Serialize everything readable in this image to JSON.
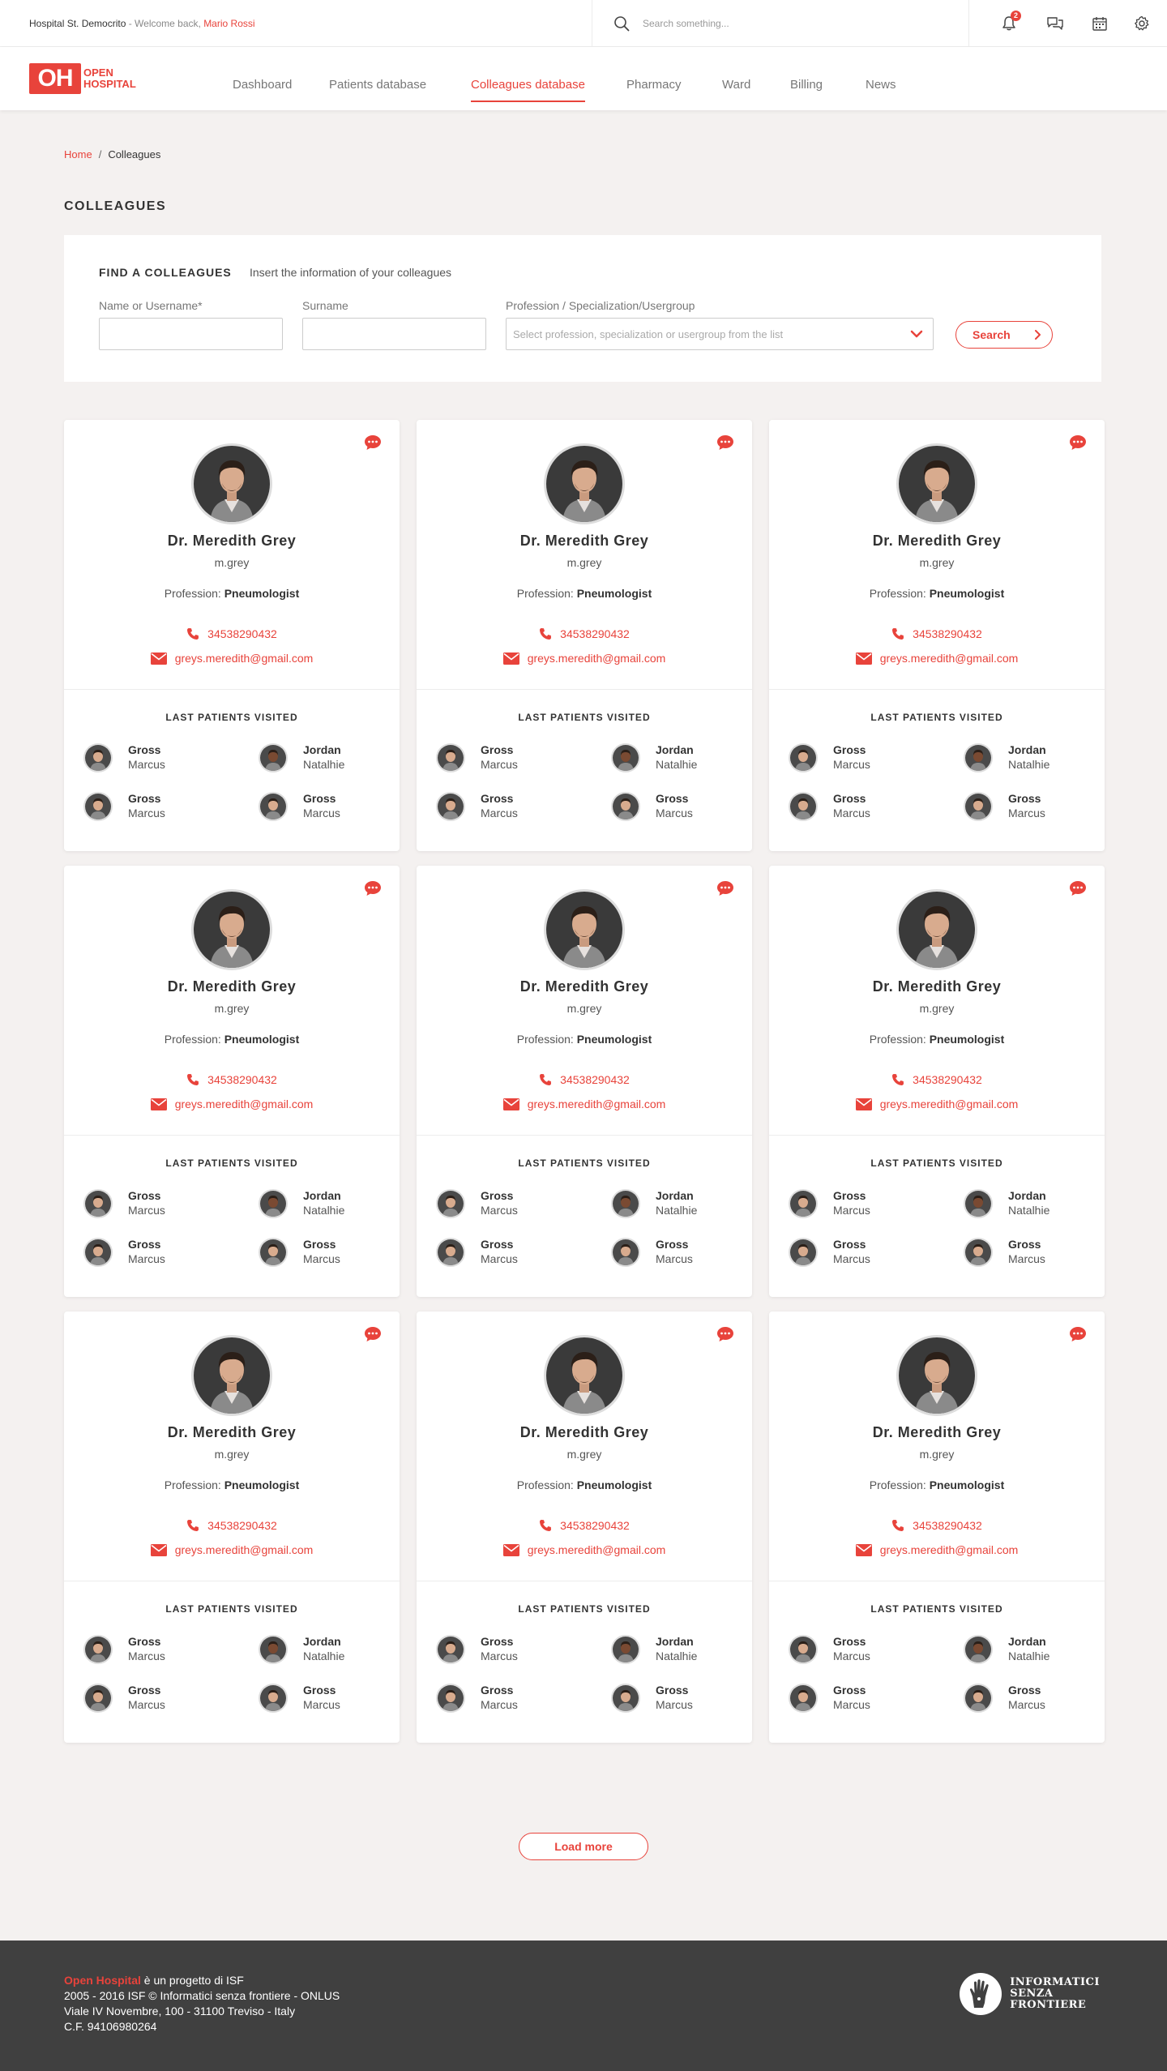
{
  "topbar": {
    "hospital": "Hospital St. Democrito",
    "welcome": " - Welcome back, ",
    "user": "Mario Rossi",
    "search_placeholder": "Search something...",
    "notifications_count": "2"
  },
  "logo": {
    "mark": "OH",
    "line1": "OPEN",
    "line2": "HOSPITAL"
  },
  "nav": [
    {
      "label": "Dashboard"
    },
    {
      "label": "Patients database"
    },
    {
      "label": "Colleagues database"
    },
    {
      "label": "Pharmacy"
    },
    {
      "label": "Ward"
    },
    {
      "label": "Billing"
    },
    {
      "label": "News"
    }
  ],
  "breadcrumb": {
    "home": "Home",
    "sep": "/",
    "current": "Colleagues"
  },
  "page_title": "COLLEAGUES",
  "find": {
    "title": "FIND A COLLEAGUES",
    "description": "Insert the information of your colleagues",
    "name_label": "Name or Username*",
    "surname_label": "Surname",
    "profession_label": "Profession / Specialization/Usergroup",
    "profession_placeholder": "Select profession, specialization or usergroup from the list",
    "search_label": "Search"
  },
  "card": {
    "name": "Dr. Meredith Grey",
    "username": "m.grey",
    "profession_prefix": "Profession: ",
    "profession": "Pneumologist",
    "phone": "34538290432",
    "email": "greys.meredith@gmail.com",
    "last_patients_title": "LAST PATIENTS VISITED",
    "patients": [
      {
        "surname": "Gross",
        "name": "Marcus"
      },
      {
        "surname": "Jordan",
        "name": "Natalhie"
      },
      {
        "surname": "Gross",
        "name": "Marcus"
      },
      {
        "surname": "Gross",
        "name": "Marcus"
      }
    ]
  },
  "load_more": "Load more",
  "footer": {
    "brand": "Open Hospital",
    "line1": " è un progetto di ISF",
    "line2": "2005 - 2016 ISF © Informatici senza frontiere - ONLUS",
    "line3": "Viale IV Novembre, 100 - 31100 Treviso - Italy",
    "line4": "C.F. 94106980264",
    "isf1": "INFORMATICI",
    "isf2": "SENZA",
    "isf3": "FRONTIERE"
  },
  "colors": {
    "accent": "#e8433b",
    "footer_bg": "#404040",
    "page_bg": "#f4f1f0"
  }
}
